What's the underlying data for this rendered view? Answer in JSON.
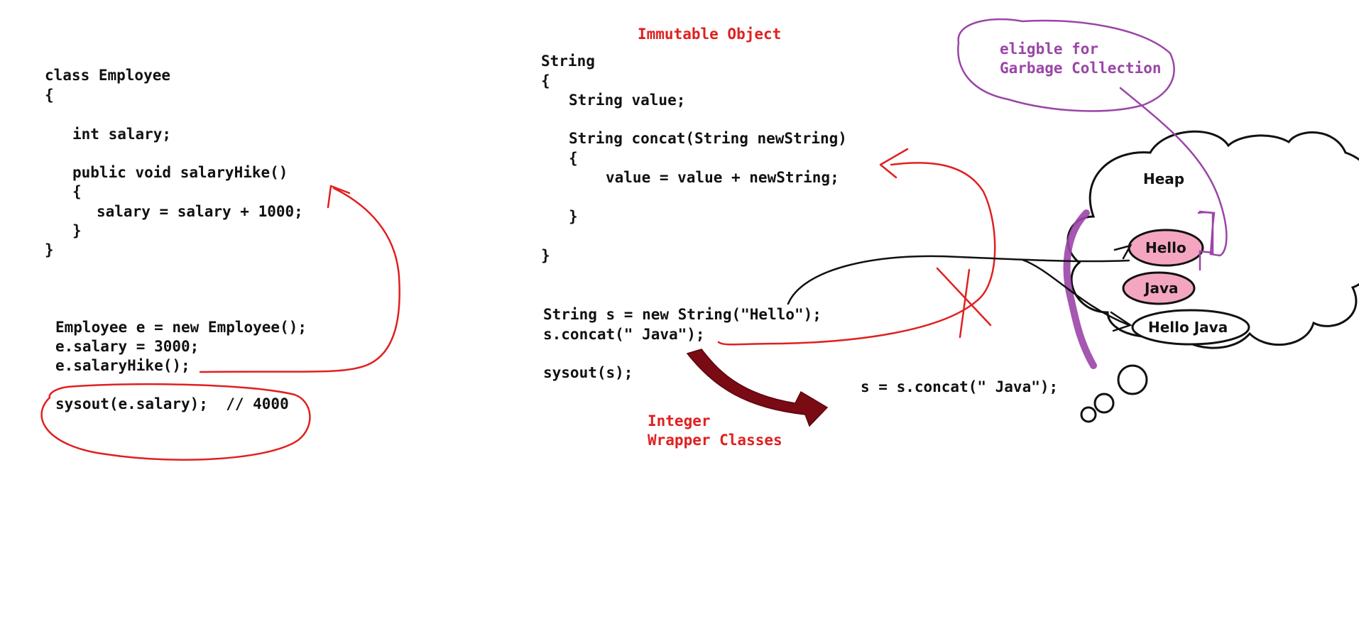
{
  "employee_code": {
    "class_decl": "class Employee",
    "open_brace": "{",
    "field": "int salary;",
    "method_sig": "public void salaryHike()",
    "method_open": "{",
    "method_body": "salary = salary + 1000;",
    "method_close": "}",
    "close_brace": "}",
    "main_line1": "Employee e = new Employee();",
    "main_line2": "e.salary = 3000;",
    "main_line3": "e.salaryHike();",
    "sysout": "sysout(e.salary);  // 4000"
  },
  "string_code": {
    "heading": "Immutable Object",
    "class_decl": "String",
    "open_brace": "{",
    "field": "String value;",
    "method_sig": "String concat(String newString)",
    "method_open": "{",
    "method_body": "value = value + newString;",
    "method_close": "}",
    "close_brace": "}",
    "main_line1": "String s = new String(\"Hello\");",
    "main_line2": "s.concat(\" Java\");",
    "sysout": "sysout(s);",
    "fix_line": "s = s.concat(\" Java\");",
    "next_topic_line1": "Integer",
    "next_topic_line2": "Wrapper Classes"
  },
  "heap": {
    "title": "Heap",
    "objects": [
      "Hello",
      "Java",
      "Hello Java"
    ],
    "gc_note_line1": "eligble for",
    "gc_note_line2": "Garbage Collection"
  },
  "colors": {
    "ink_red": "#e02020",
    "ink_purple": "#9b45a8",
    "ink_dark_red": "#7a0a14",
    "pink_fill": "#f4a6c0",
    "text": "#111111"
  }
}
